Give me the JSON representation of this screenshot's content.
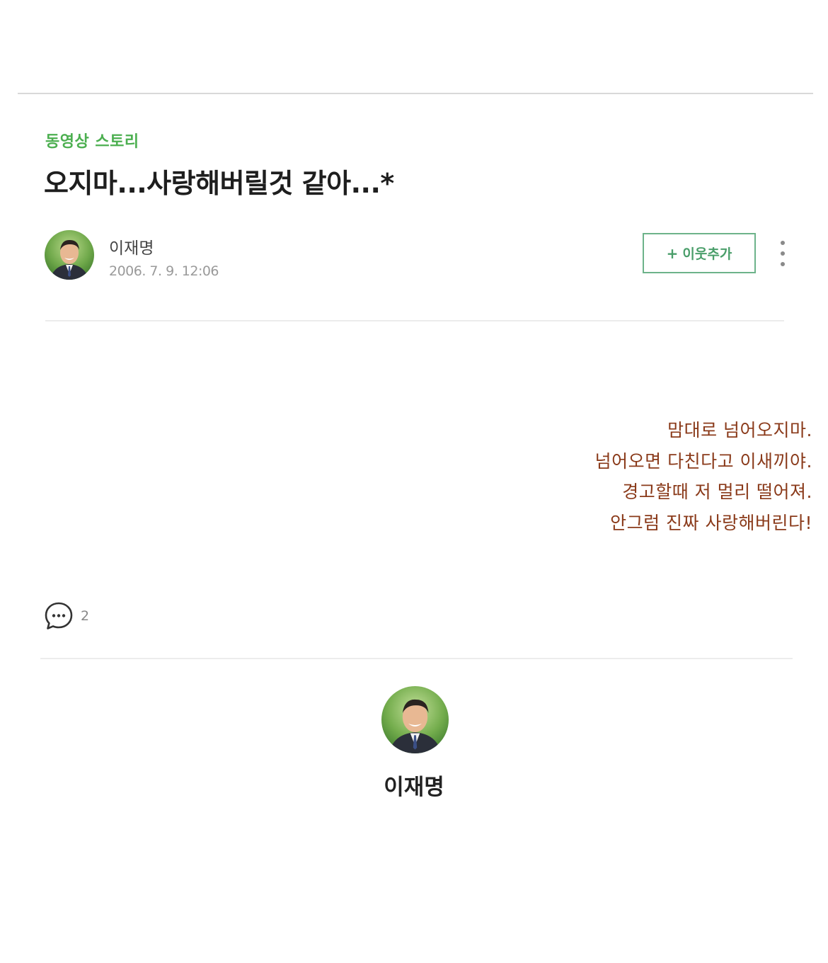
{
  "post": {
    "category": "동영상 스토리",
    "title": "오지마...사랑해버릴것 같아...*",
    "author": "이재명",
    "date": "2006. 7. 9. 12:06",
    "body_lines": [
      "맘대로 넘어오지마.",
      "넘어오면 다친다고 이새끼야.",
      "경고할때 저 멀리 떨어져.",
      "안그럼 진짜 사랑해버린다!"
    ],
    "body_color": "#8a3a1a"
  },
  "actions": {
    "add_neighbor_label": "이웃추가",
    "add_neighbor_icon": "plus-icon",
    "more_icon": "more-vertical-icon"
  },
  "comments": {
    "icon": "comment-bubble-icon",
    "count": "2"
  },
  "profile": {
    "name": "이재명"
  },
  "colors": {
    "category_green": "#4caf50",
    "button_border": "#6db38a",
    "button_text": "#4a9e6a"
  }
}
